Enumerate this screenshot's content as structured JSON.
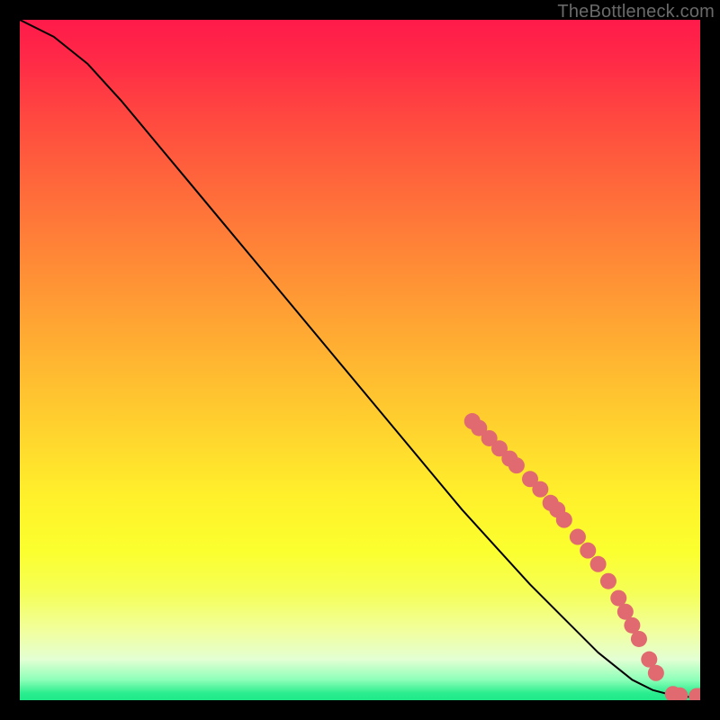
{
  "watermark": "TheBottleneck.com",
  "chart_data": {
    "type": "line",
    "title": "",
    "xlabel": "",
    "ylabel": "",
    "xlim": [
      0,
      100
    ],
    "ylim": [
      0,
      100
    ],
    "curve": {
      "x": [
        0,
        5,
        10,
        15,
        20,
        25,
        30,
        35,
        40,
        45,
        50,
        55,
        60,
        65,
        70,
        75,
        80,
        85,
        90,
        93,
        96,
        98,
        100
      ],
      "y": [
        100,
        97.5,
        93.5,
        88,
        82,
        76,
        70,
        64,
        58,
        52,
        46,
        40,
        34,
        28,
        22.5,
        17,
        12,
        7,
        3,
        1.5,
        0.7,
        0.5,
        0.5
      ]
    },
    "markers": {
      "color": "#e06a6f",
      "radius_px": 9,
      "points": [
        {
          "x": 66.5,
          "y": 41.0
        },
        {
          "x": 67.5,
          "y": 40.0
        },
        {
          "x": 69.0,
          "y": 38.5
        },
        {
          "x": 70.5,
          "y": 37.0
        },
        {
          "x": 72.0,
          "y": 35.5
        },
        {
          "x": 73.0,
          "y": 34.5
        },
        {
          "x": 75.0,
          "y": 32.5
        },
        {
          "x": 76.5,
          "y": 31.0
        },
        {
          "x": 78.0,
          "y": 29.0
        },
        {
          "x": 79.0,
          "y": 28.0
        },
        {
          "x": 80.0,
          "y": 26.5
        },
        {
          "x": 82.0,
          "y": 24.0
        },
        {
          "x": 83.5,
          "y": 22.0
        },
        {
          "x": 85.0,
          "y": 20.0
        },
        {
          "x": 86.5,
          "y": 17.5
        },
        {
          "x": 88.0,
          "y": 15.0
        },
        {
          "x": 89.0,
          "y": 13.0
        },
        {
          "x": 90.0,
          "y": 11.0
        },
        {
          "x": 91.0,
          "y": 9.0
        },
        {
          "x": 92.5,
          "y": 6.0
        },
        {
          "x": 93.5,
          "y": 4.0
        },
        {
          "x": 96.0,
          "y": 0.9
        },
        {
          "x": 97.0,
          "y": 0.7
        },
        {
          "x": 99.5,
          "y": 0.6
        },
        {
          "x": 100.0,
          "y": 0.6
        }
      ]
    }
  }
}
